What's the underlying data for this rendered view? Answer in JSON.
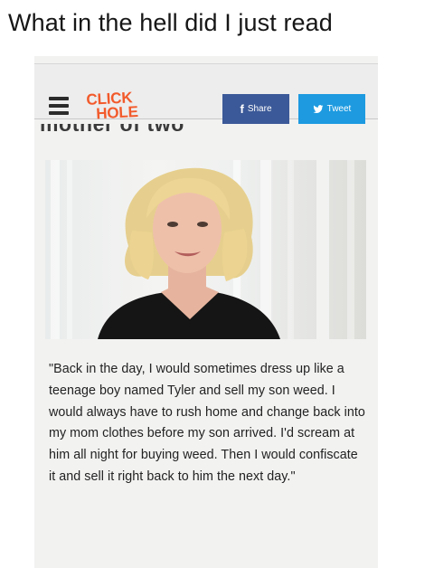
{
  "caption": "What in the hell did I just read",
  "header": {
    "logo": {
      "line1": "CLICK",
      "line2": "HOLE",
      "color": "#f25a2b"
    },
    "share_label": "Share",
    "tweet_label": "Tweet",
    "share_icon": "facebook-icon",
    "tweet_icon": "twitter-bird-icon",
    "share_color": "#3b5998",
    "tweet_color": "#1d9ae0"
  },
  "article": {
    "cut_headline": "mother of two",
    "quote": "\"Back in the day, I would sometimes dress up like a teenage boy named Tyler and sell my son weed. I would always have to rush home and change back into my mom clothes before my son arrived. I'd scream at him all night for buying weed. Then I would confiscate it and sell it right back to him the next day.\""
  }
}
